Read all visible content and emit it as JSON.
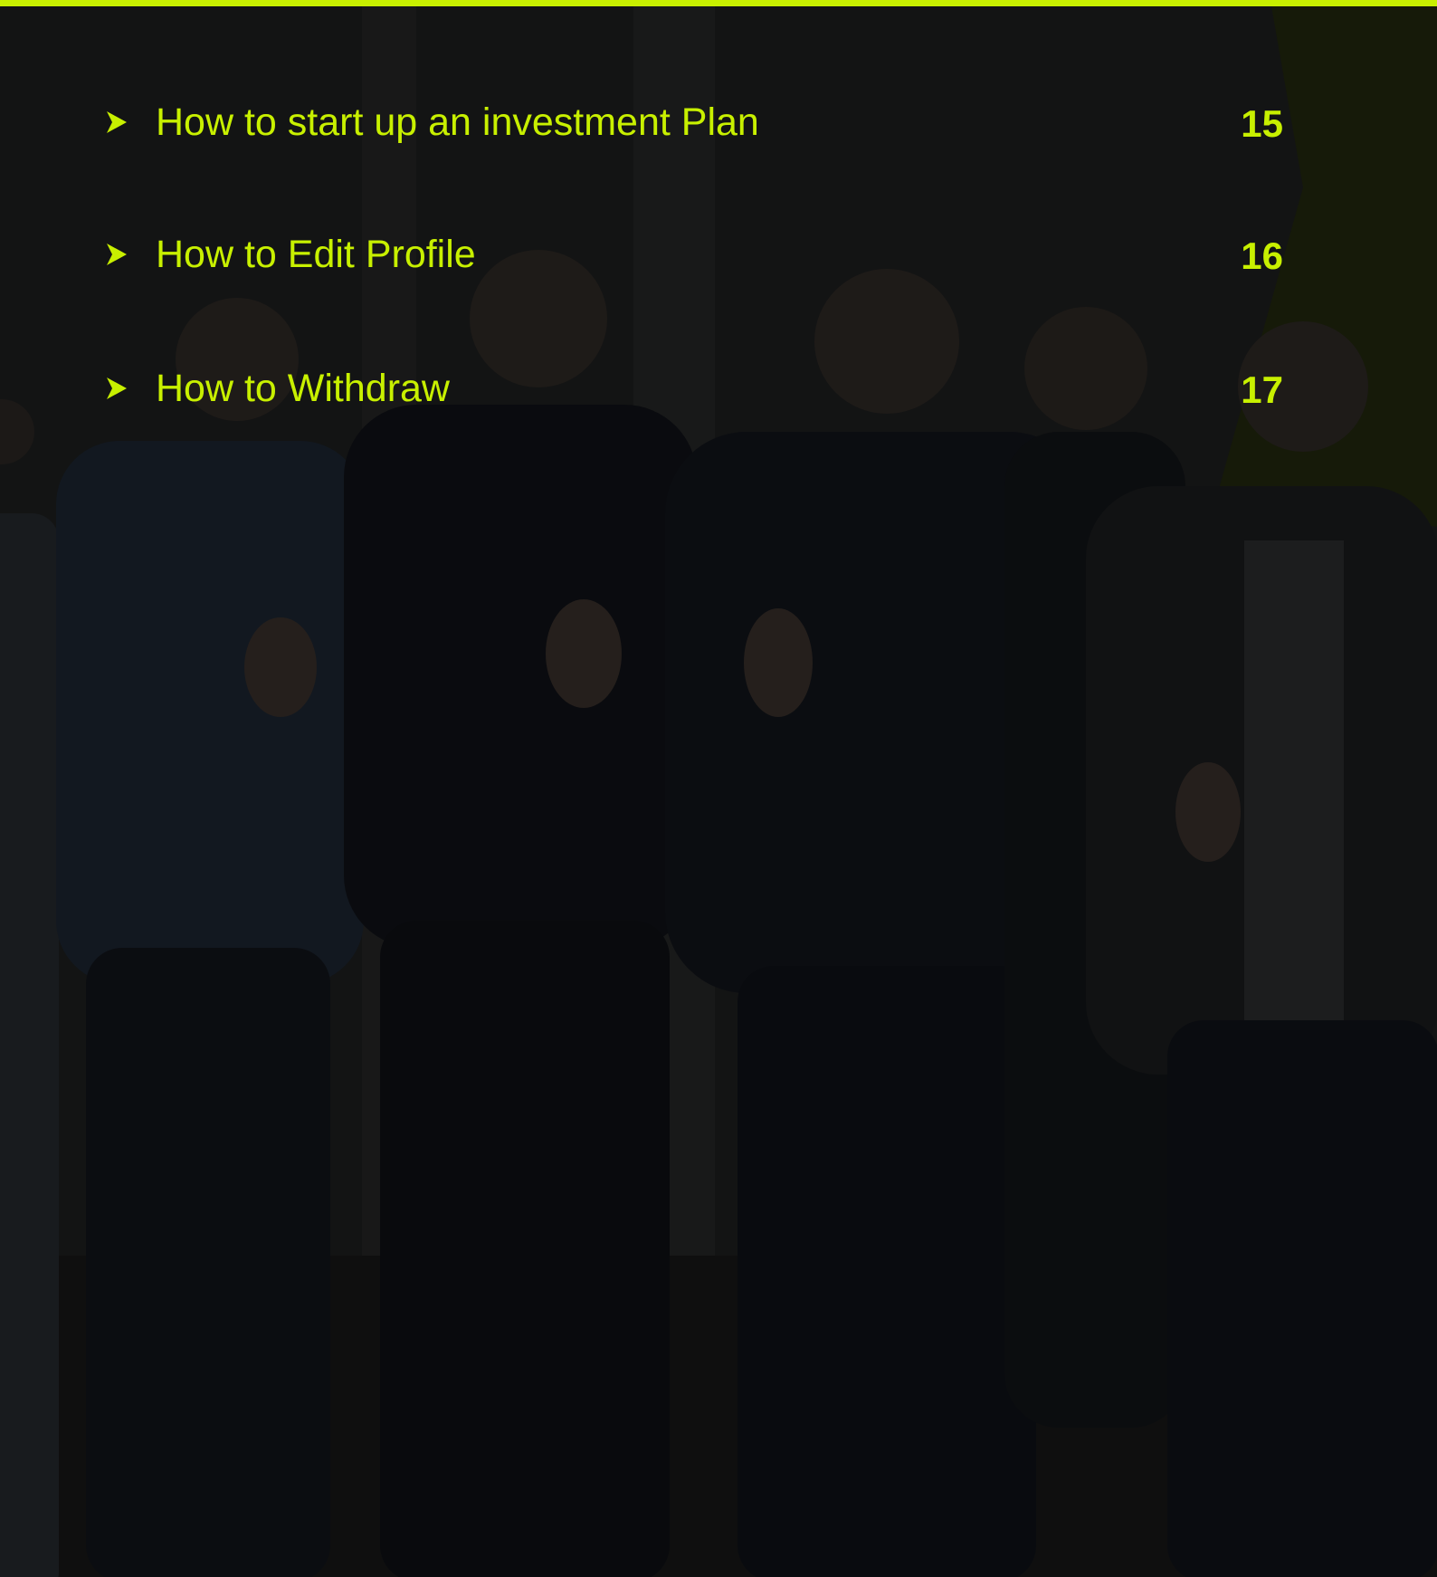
{
  "accent_color": "#c8f000",
  "background_image": {
    "subject": "group-photo-thumbs-up",
    "overlay": "dark"
  },
  "toc": {
    "items": [
      {
        "label": "How to start up an investment Plan",
        "page": "15",
        "icon": "arrow-bullet-icon"
      },
      {
        "label": "How to Edit Profile",
        "page": "16",
        "icon": "arrow-bullet-icon"
      },
      {
        "label": "How to Withdraw",
        "page": "17",
        "icon": "arrow-bullet-icon"
      }
    ]
  }
}
